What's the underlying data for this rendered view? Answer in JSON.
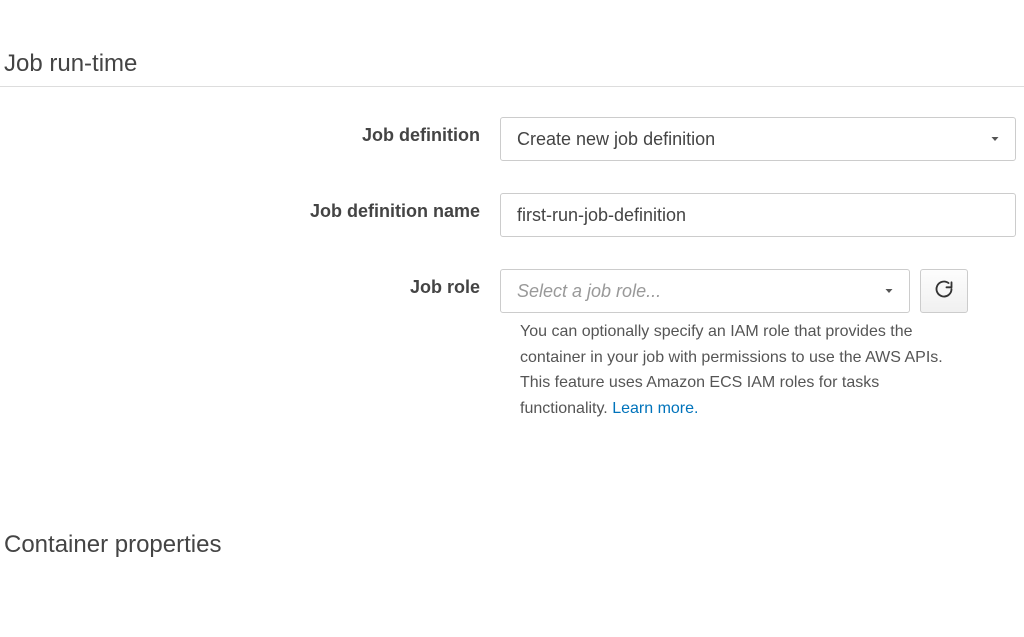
{
  "sections": {
    "job_runtime_title": "Job run-time",
    "container_props_title": "Container properties"
  },
  "fields": {
    "job_definition": {
      "label": "Job definition",
      "selected": "Create new job definition"
    },
    "job_definition_name": {
      "label": "Job definition name",
      "value": "first-run-job-definition"
    },
    "job_role": {
      "label": "Job role",
      "placeholder": "Select a job role...",
      "help": "You can optionally specify an IAM role that provides the container in your job with permissions to use the AWS APIs. This feature uses Amazon ECS IAM roles for tasks functionality. ",
      "learn_more": "Learn more."
    }
  }
}
